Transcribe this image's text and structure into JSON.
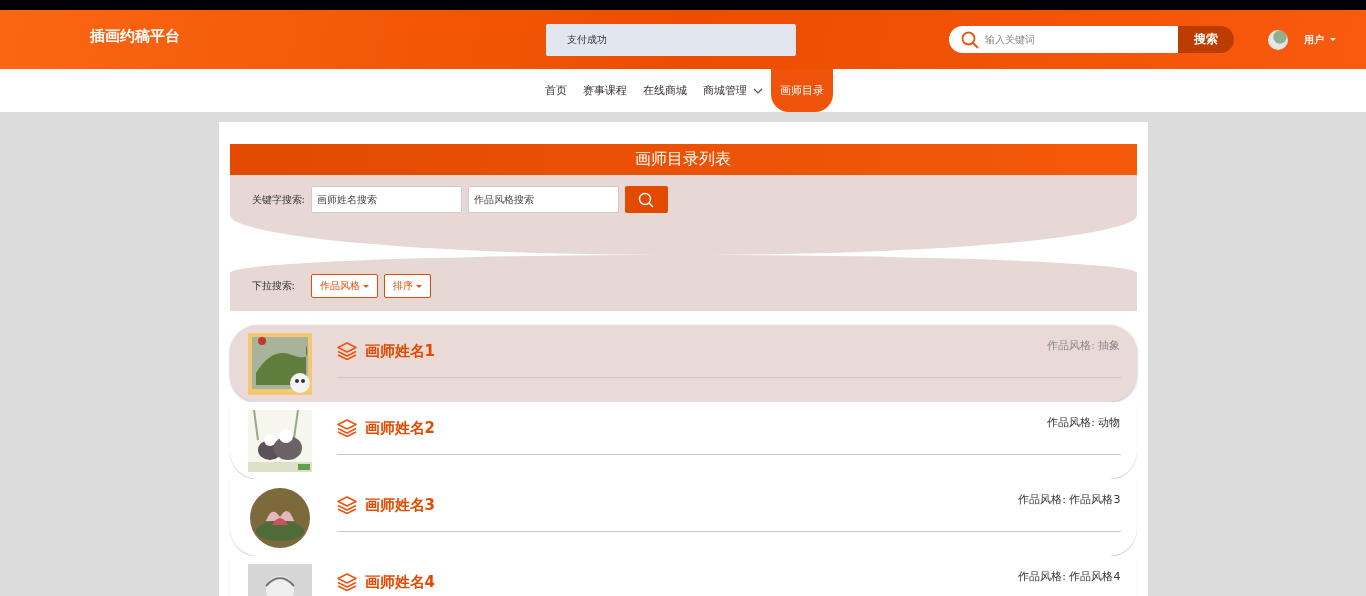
{
  "header": {
    "logo": "插画约稿平台",
    "toast": "支付成功",
    "search": {
      "placeholder": "输入关键词",
      "button": "搜索"
    },
    "user": {
      "name": "用户"
    }
  },
  "nav": [
    {
      "label": "首页",
      "selected": false,
      "dropdown": false
    },
    {
      "label": "赛事课程",
      "selected": false,
      "dropdown": false
    },
    {
      "label": "在线商城",
      "selected": false,
      "dropdown": false
    },
    {
      "label": "商城管理",
      "selected": false,
      "dropdown": true
    },
    {
      "label": "画师目录",
      "selected": true,
      "dropdown": false
    }
  ],
  "panel": {
    "title": "画师目录列表",
    "keyword_search": {
      "label": "关键字搜索:",
      "fields": [
        {
          "placeholder": "画师姓名搜索"
        },
        {
          "placeholder": "作品风格搜索"
        }
      ]
    },
    "dropdown_search": {
      "label": "下拉搜索:",
      "buttons": [
        "作品风格",
        "排序"
      ]
    }
  },
  "artists": [
    {
      "name": "画师姓名1",
      "style": "作品风格: 抽象",
      "highlighted": true
    },
    {
      "name": "画师姓名2",
      "style": "作品风格: 动物",
      "highlighted": false
    },
    {
      "name": "画师姓名3",
      "style": "作品风格: 作品风格3",
      "highlighted": false
    },
    {
      "name": "画师姓名4",
      "style": "作品风格: 作品风格4",
      "highlighted": false
    }
  ]
}
